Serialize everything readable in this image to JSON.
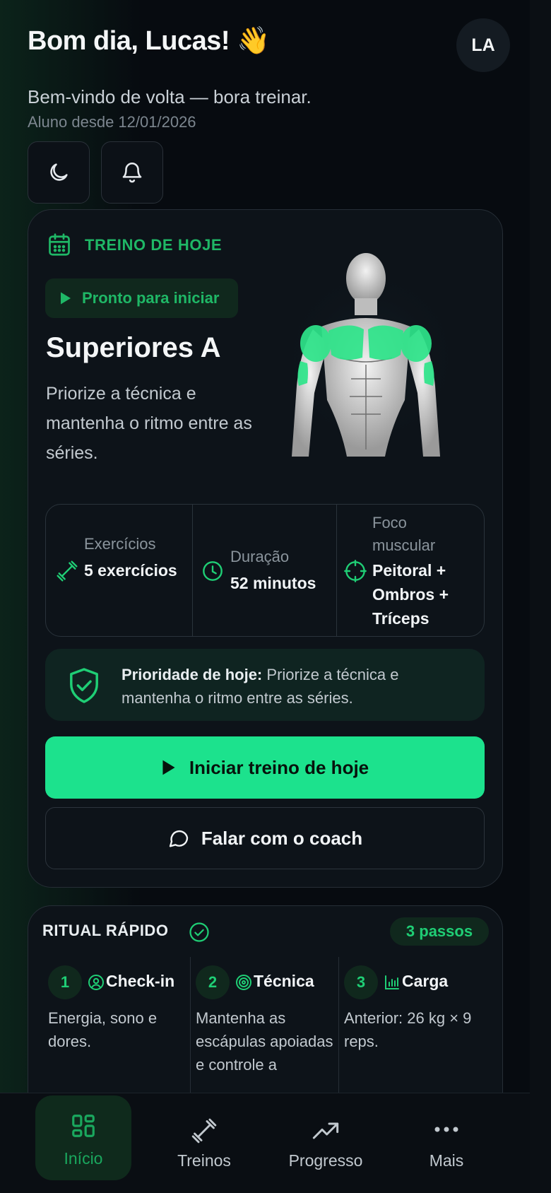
{
  "header": {
    "greeting": "Bom dia, Lucas! 👋",
    "avatar_initials": "LA",
    "welcome": "Bem-vindo de volta — bora treinar.",
    "member_since": "Aluno desde 12/01/2026",
    "theme_toggle_icon": "moon-icon",
    "notifications_icon": "bell-icon"
  },
  "today": {
    "eyebrow": "TREINO DE HOJE",
    "status_chip": "Pronto para iniciar",
    "title": "Superiores A",
    "description": "Priorize a técnica e mantenha o ritmo entre as séries.",
    "stats": [
      {
        "label": "Exercícios",
        "value": "5 exercícios",
        "icon": "dumbbell-icon"
      },
      {
        "label": "Duração",
        "value": "52 minutos",
        "icon": "clock-icon"
      },
      {
        "label": "Foco muscular",
        "value": "Peitoral + Ombros + Tríceps",
        "icon": "crosshair-icon"
      }
    ],
    "priority_label": "Prioridade de hoje:",
    "priority_text": "Priorize a técnica e mantenha o ritmo entre as séries.",
    "primary_button": "Iniciar treino de hoje",
    "secondary_button": "Falar com o coach",
    "muscle_highlight_color": "#2ee58a"
  },
  "ritual": {
    "title": "RITUAL RÁPIDO",
    "steps_badge": "3 passos",
    "steps": [
      {
        "number": "1",
        "title": "Check-in",
        "icon": "user-circle-icon",
        "description": "Energia, sono e dores."
      },
      {
        "number": "2",
        "title": "Técnica",
        "icon": "target-icon",
        "description": "Mantenha as escápulas apoiadas e controle a"
      },
      {
        "number": "3",
        "title": "Carga",
        "icon": "bar-chart-icon",
        "description": "Anterior: 26 kg × 9 reps."
      }
    ]
  },
  "nav": {
    "items": [
      {
        "label": "Início",
        "icon": "grid-icon",
        "active": true
      },
      {
        "label": "Treinos",
        "icon": "dumbbell-icon",
        "active": false
      },
      {
        "label": "Progresso",
        "icon": "trending-up-icon",
        "active": false
      },
      {
        "label": "Mais",
        "icon": "more-dots-icon",
        "active": false
      }
    ]
  },
  "colors": {
    "accent": "#1ce28d",
    "accent_text": "#1fb766",
    "background": "#070b10",
    "card": "#0d1319"
  }
}
